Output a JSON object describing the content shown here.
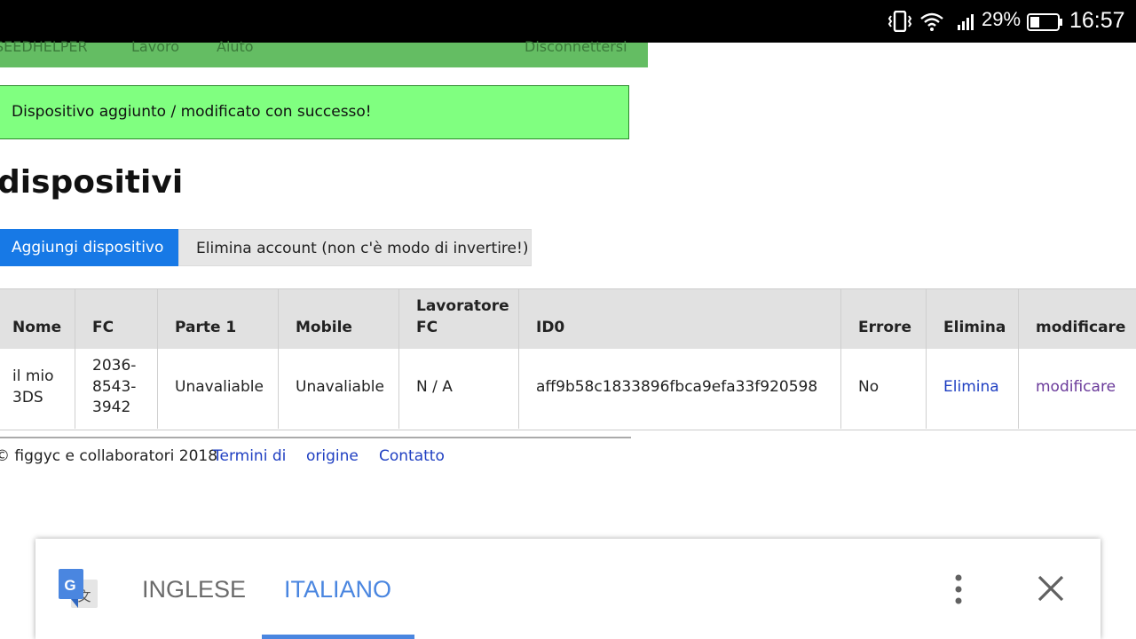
{
  "status_bar": {
    "battery_percent": "29%",
    "time": "16:57",
    "icons": [
      "vibrate-icon",
      "wifi-icon",
      "signal-icon",
      "battery-icon"
    ]
  },
  "nav": {
    "brand": "SEEDHELPER",
    "lavoro": "Lavoro",
    "aiuto": "Aiuto",
    "logout": "Disconnettersi"
  },
  "alert": {
    "message": "Dispositivo aggiunto / modificato con successo!"
  },
  "page_title": "dispositivi",
  "buttons": {
    "add": "Aggiungi dispositivo",
    "delete_account": "Elimina account (non c'è modo di invertire!)"
  },
  "table": {
    "headers": {
      "nome": "Nome",
      "fc": "FC",
      "parte1": "Parte 1",
      "mobile": "Mobile",
      "lavoratore_1": "Lavoratore",
      "lavoratore_2": "FC",
      "id0": "ID0",
      "errore": "Errore",
      "elimina": "Elimina",
      "modificare": "modificare"
    },
    "row": {
      "nome_1": "il mio",
      "nome_2": "3DS",
      "fc_1": "2036-",
      "fc_2": "8543-",
      "fc_3": "3942",
      "parte1": "Unavaliable",
      "mobile": "Unavaliable",
      "lavoratore": "N / A",
      "id0": "aff9b58c1833896fbca9efa33f920598",
      "errore": "No",
      "elimina": "Elimina",
      "modificare": "modificare"
    }
  },
  "footer": {
    "copyright": "© figgyc e collaboratori 2018",
    "termini": "Termini di",
    "origine": "origine",
    "contatto": "Contatto"
  },
  "translate_bar": {
    "source_lang": "INGLESE",
    "target_lang": "ITALIANO",
    "colors": {
      "active": "#4a86e0",
      "inactive": "#6b6b6b"
    }
  },
  "colors": {
    "nav_green": "#64bd63",
    "alert_green": "#80ff80",
    "primary_blue": "#1779e6",
    "link": "#1f3fc2",
    "visited_link": "#6a3a9a"
  }
}
